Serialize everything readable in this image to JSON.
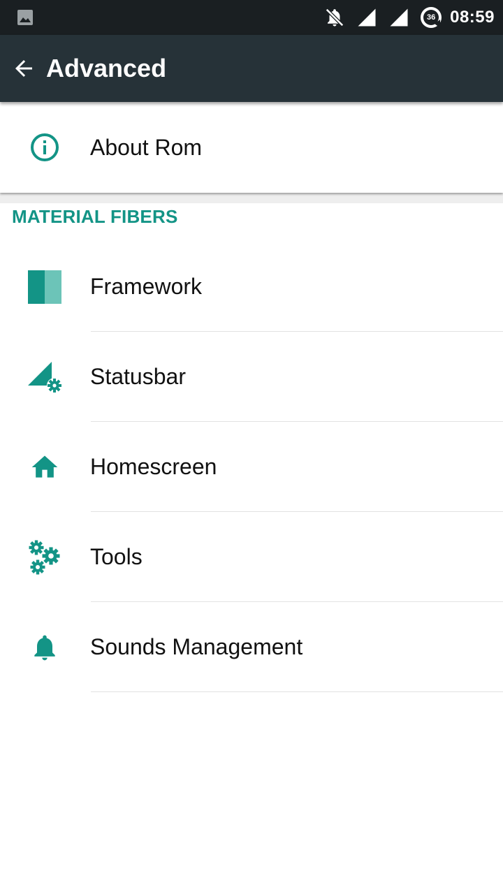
{
  "status_bar": {
    "time": "08:59",
    "network_badge": "36",
    "icons": [
      "image-icon",
      "notifications-off-icon",
      "signal-icon",
      "signal-icon",
      "data-indicator-icon"
    ]
  },
  "app_bar": {
    "title": "Advanced",
    "back_icon": "arrow-back-icon"
  },
  "about": {
    "label": "About Rom",
    "icon": "info-icon"
  },
  "section": {
    "header": "MATERIAL FIBERS",
    "items": [
      {
        "label": "Framework",
        "icon": "framework-icon"
      },
      {
        "label": "Statusbar",
        "icon": "statusbar-settings-icon"
      },
      {
        "label": "Homescreen",
        "icon": "home-icon"
      },
      {
        "label": "Tools",
        "icon": "gears-icon"
      },
      {
        "label": "Sounds Management",
        "icon": "bell-icon"
      }
    ]
  },
  "colors": {
    "accent": "#139486",
    "accent_light": "#6cc4b8",
    "app_bar": "#263238",
    "status_bar": "#1a1f22"
  }
}
